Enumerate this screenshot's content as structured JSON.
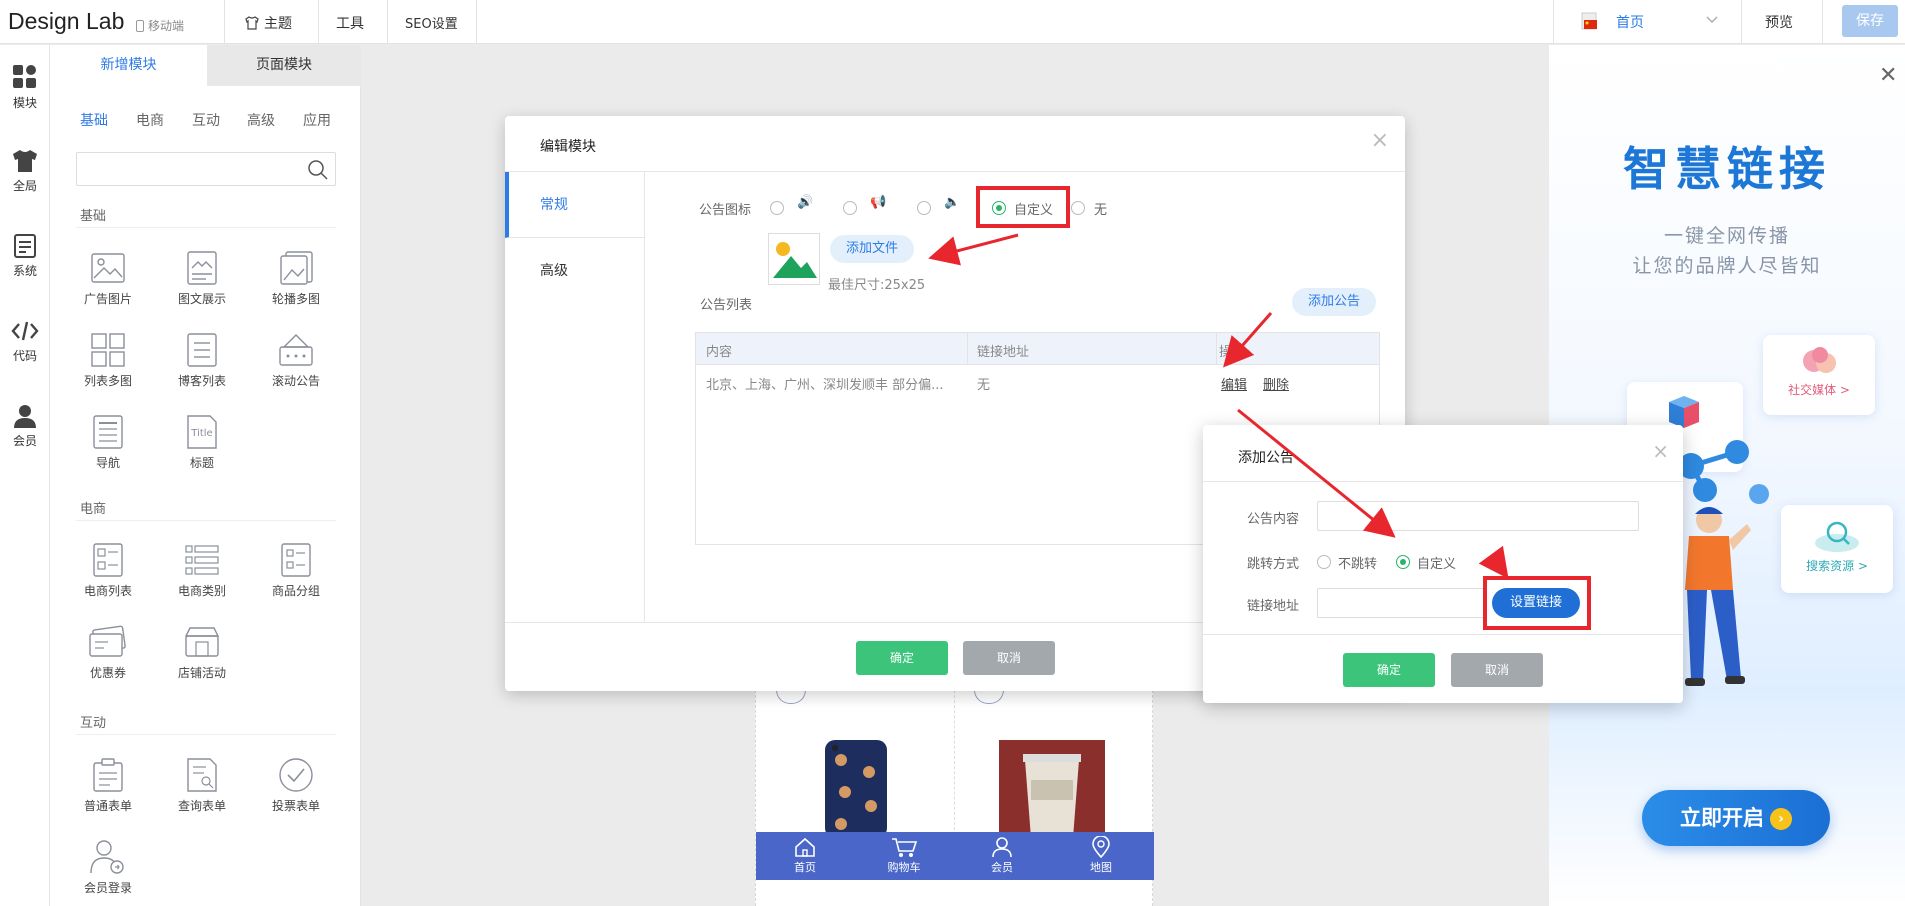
{
  "topbar": {
    "logo": "Design Lab",
    "mobile": "移动端",
    "nav": [
      "主题",
      "工具",
      "SEO设置"
    ],
    "page_select": "首页",
    "preview": "预览",
    "save": "保存"
  },
  "rail": [
    "模块",
    "全局",
    "系统",
    "代码",
    "会员"
  ],
  "panel": {
    "tabs": [
      "新增模块",
      "页面模块"
    ],
    "subtabs": [
      "基础",
      "电商",
      "互动",
      "高级",
      "应用"
    ],
    "search_placeholder": "",
    "sections": {
      "basic": {
        "title": "基础",
        "items": [
          "广告图片",
          "图文展示",
          "轮播多图",
          "列表多图",
          "博客列表",
          "滚动公告",
          "导航",
          "标题"
        ]
      },
      "ecommerce": {
        "title": "电商",
        "items": [
          "电商列表",
          "电商类别",
          "商品分组",
          "优惠券",
          "店铺活动"
        ]
      },
      "interactive": {
        "title": "互动",
        "items": [
          "普通表单",
          "查询表单",
          "投票表单",
          "会员登录"
        ]
      }
    }
  },
  "edit_dialog": {
    "title": "编辑模块",
    "side_tabs": [
      "常规",
      "高级"
    ],
    "icon_label": "公告图标",
    "icon_options": [
      "自定义",
      "无"
    ],
    "selected_icon_option": "自定义",
    "add_file": "添加文件",
    "best_size": "最佳尺寸:25x25",
    "list_label": "公告列表",
    "add_notice": "添加公告",
    "table": {
      "headers": [
        "内容",
        "链接地址",
        "操作"
      ],
      "rows": [
        {
          "content": "北京、上海、广州、深圳发顺丰 部分偏...",
          "link": "无",
          "actions": [
            "编辑",
            "删除"
          ]
        }
      ]
    },
    "ok": "确定",
    "cancel": "取消"
  },
  "add_dialog": {
    "title": "添加公告",
    "content_label": "公告内容",
    "content_value": "",
    "jump_label": "跳转方式",
    "jump_options": [
      "不跳转",
      "自定义"
    ],
    "jump_selected": "自定义",
    "link_label": "链接地址",
    "link_value": "",
    "set_link": "设置链接",
    "ok": "确定",
    "cancel": "取消"
  },
  "phone_nav": [
    "首页",
    "购物车",
    "会员",
    "地图"
  ],
  "promo": {
    "title": "智慧链接",
    "line1": "一键全网传播",
    "line2": "让您的品牌人尽皆知",
    "card_social": "社交媒体 >",
    "card_search": "搜索资源 >",
    "start": "立即开启"
  },
  "colors": {
    "accent": "#2d7be5",
    "ok_green": "#3cc47b",
    "annotation_red": "#e8262d",
    "phone_nav": "#4a66c9"
  }
}
